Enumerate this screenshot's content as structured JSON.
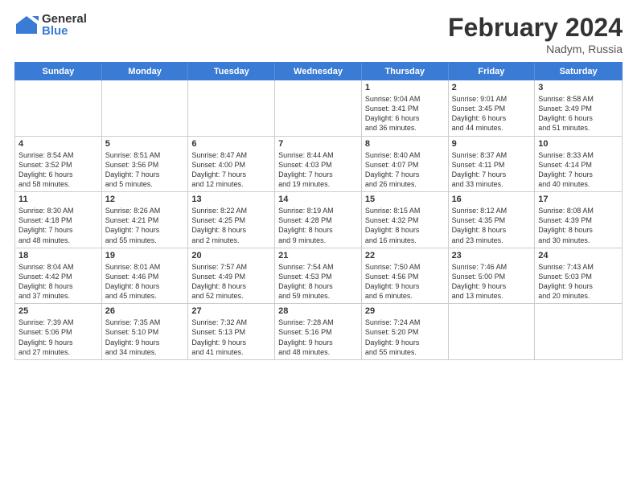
{
  "header": {
    "logo_general": "General",
    "logo_blue": "Blue",
    "month_title": "February 2024",
    "location": "Nadym, Russia"
  },
  "days_of_week": [
    "Sunday",
    "Monday",
    "Tuesday",
    "Wednesday",
    "Thursday",
    "Friday",
    "Saturday"
  ],
  "weeks": [
    [
      {
        "day": "",
        "text": ""
      },
      {
        "day": "",
        "text": ""
      },
      {
        "day": "",
        "text": ""
      },
      {
        "day": "",
        "text": ""
      },
      {
        "day": "1",
        "text": "Sunrise: 9:04 AM\nSunset: 3:41 PM\nDaylight: 6 hours\nand 36 minutes."
      },
      {
        "day": "2",
        "text": "Sunrise: 9:01 AM\nSunset: 3:45 PM\nDaylight: 6 hours\nand 44 minutes."
      },
      {
        "day": "3",
        "text": "Sunrise: 8:58 AM\nSunset: 3:49 PM\nDaylight: 6 hours\nand 51 minutes."
      }
    ],
    [
      {
        "day": "4",
        "text": "Sunrise: 8:54 AM\nSunset: 3:52 PM\nDaylight: 6 hours\nand 58 minutes."
      },
      {
        "day": "5",
        "text": "Sunrise: 8:51 AM\nSunset: 3:56 PM\nDaylight: 7 hours\nand 5 minutes."
      },
      {
        "day": "6",
        "text": "Sunrise: 8:47 AM\nSunset: 4:00 PM\nDaylight: 7 hours\nand 12 minutes."
      },
      {
        "day": "7",
        "text": "Sunrise: 8:44 AM\nSunset: 4:03 PM\nDaylight: 7 hours\nand 19 minutes."
      },
      {
        "day": "8",
        "text": "Sunrise: 8:40 AM\nSunset: 4:07 PM\nDaylight: 7 hours\nand 26 minutes."
      },
      {
        "day": "9",
        "text": "Sunrise: 8:37 AM\nSunset: 4:11 PM\nDaylight: 7 hours\nand 33 minutes."
      },
      {
        "day": "10",
        "text": "Sunrise: 8:33 AM\nSunset: 4:14 PM\nDaylight: 7 hours\nand 40 minutes."
      }
    ],
    [
      {
        "day": "11",
        "text": "Sunrise: 8:30 AM\nSunset: 4:18 PM\nDaylight: 7 hours\nand 48 minutes."
      },
      {
        "day": "12",
        "text": "Sunrise: 8:26 AM\nSunset: 4:21 PM\nDaylight: 7 hours\nand 55 minutes."
      },
      {
        "day": "13",
        "text": "Sunrise: 8:22 AM\nSunset: 4:25 PM\nDaylight: 8 hours\nand 2 minutes."
      },
      {
        "day": "14",
        "text": "Sunrise: 8:19 AM\nSunset: 4:28 PM\nDaylight: 8 hours\nand 9 minutes."
      },
      {
        "day": "15",
        "text": "Sunrise: 8:15 AM\nSunset: 4:32 PM\nDaylight: 8 hours\nand 16 minutes."
      },
      {
        "day": "16",
        "text": "Sunrise: 8:12 AM\nSunset: 4:35 PM\nDaylight: 8 hours\nand 23 minutes."
      },
      {
        "day": "17",
        "text": "Sunrise: 8:08 AM\nSunset: 4:39 PM\nDaylight: 8 hours\nand 30 minutes."
      }
    ],
    [
      {
        "day": "18",
        "text": "Sunrise: 8:04 AM\nSunset: 4:42 PM\nDaylight: 8 hours\nand 37 minutes."
      },
      {
        "day": "19",
        "text": "Sunrise: 8:01 AM\nSunset: 4:46 PM\nDaylight: 8 hours\nand 45 minutes."
      },
      {
        "day": "20",
        "text": "Sunrise: 7:57 AM\nSunset: 4:49 PM\nDaylight: 8 hours\nand 52 minutes."
      },
      {
        "day": "21",
        "text": "Sunrise: 7:54 AM\nSunset: 4:53 PM\nDaylight: 8 hours\nand 59 minutes."
      },
      {
        "day": "22",
        "text": "Sunrise: 7:50 AM\nSunset: 4:56 PM\nDaylight: 9 hours\nand 6 minutes."
      },
      {
        "day": "23",
        "text": "Sunrise: 7:46 AM\nSunset: 5:00 PM\nDaylight: 9 hours\nand 13 minutes."
      },
      {
        "day": "24",
        "text": "Sunrise: 7:43 AM\nSunset: 5:03 PM\nDaylight: 9 hours\nand 20 minutes."
      }
    ],
    [
      {
        "day": "25",
        "text": "Sunrise: 7:39 AM\nSunset: 5:06 PM\nDaylight: 9 hours\nand 27 minutes."
      },
      {
        "day": "26",
        "text": "Sunrise: 7:35 AM\nSunset: 5:10 PM\nDaylight: 9 hours\nand 34 minutes."
      },
      {
        "day": "27",
        "text": "Sunrise: 7:32 AM\nSunset: 5:13 PM\nDaylight: 9 hours\nand 41 minutes."
      },
      {
        "day": "28",
        "text": "Sunrise: 7:28 AM\nSunset: 5:16 PM\nDaylight: 9 hours\nand 48 minutes."
      },
      {
        "day": "29",
        "text": "Sunrise: 7:24 AM\nSunset: 5:20 PM\nDaylight: 9 hours\nand 55 minutes."
      },
      {
        "day": "",
        "text": ""
      },
      {
        "day": "",
        "text": ""
      }
    ]
  ]
}
